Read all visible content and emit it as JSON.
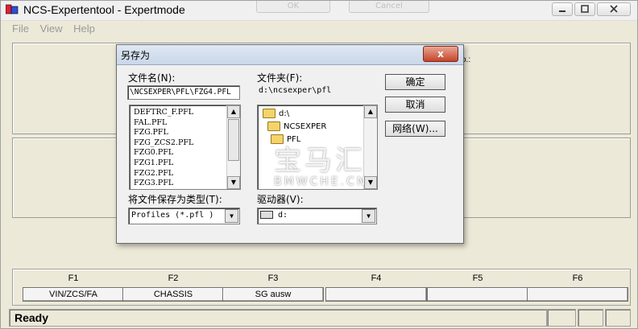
{
  "window": {
    "title": "NCS-Expertentool - Expertmode",
    "ghost_ok": "OK",
    "ghost_cancel": "Cancel",
    "title_buttons": {
      "minimize": "minimize-icon",
      "maximize": "maximize-icon",
      "close": "close-icon"
    }
  },
  "menu": [
    "File",
    "View",
    "Help"
  ],
  "background_fragment": "o.:",
  "dialog": {
    "title": "另存为",
    "close_label": "x",
    "filename_label": "文件名(N):",
    "filename_value": "\\NCSEXPER\\PFL\\FZG4.PFL",
    "files": [
      "DEFTRC_F.PFL",
      "FAL.PFL",
      "FZG.PFL",
      "FZG_ZCS2.PFL",
      "FZG0.PFL",
      "FZG1.PFL",
      "FZG2.PFL",
      "FZG3.PFL"
    ],
    "folder_label": "文件夹(F):",
    "folder_path": "d:\\ncsexper\\pfl",
    "folders": [
      "d:\\",
      "NCSEXPER",
      "PFL"
    ],
    "ok_label": "确定",
    "cancel_label": "取消",
    "network_label": "网络(W)...",
    "filetype_label": "将文件保存为类型(T):",
    "filetype_value": "Profiles (*.pfl )",
    "drive_label": "驱动器(V):",
    "drive_value": "d:"
  },
  "watermark": {
    "cn": "宝马汇",
    "en": "BMWCHE.CN"
  },
  "function_keys": [
    {
      "key": "F1",
      "label": "VIN/ZCS/FA"
    },
    {
      "key": "F2",
      "label": "CHASSIS"
    },
    {
      "key": "F3",
      "label": "SG ausw"
    },
    {
      "key": "F4",
      "label": ""
    },
    {
      "key": "F5",
      "label": ""
    },
    {
      "key": "F6",
      "label": ""
    }
  ],
  "status": {
    "text": "Ready"
  }
}
